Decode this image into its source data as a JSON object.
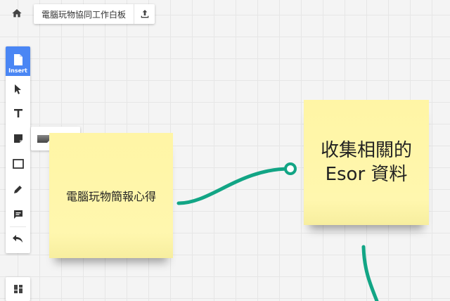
{
  "header": {
    "board_title": "電腦玩物協同工作白板"
  },
  "toolbar": {
    "insert_label": "Insert",
    "tools": [
      "select",
      "text",
      "sticky-note",
      "rectangle",
      "pen",
      "comment",
      "undo"
    ]
  },
  "notes": [
    {
      "text": "電腦玩物簡報心得"
    },
    {
      "line1": "收集相關的",
      "line2": "Esor 資料"
    }
  ],
  "colors": {
    "accent": "#4a86f4",
    "sticky": "#fff7a8",
    "connector": "#12a585"
  }
}
